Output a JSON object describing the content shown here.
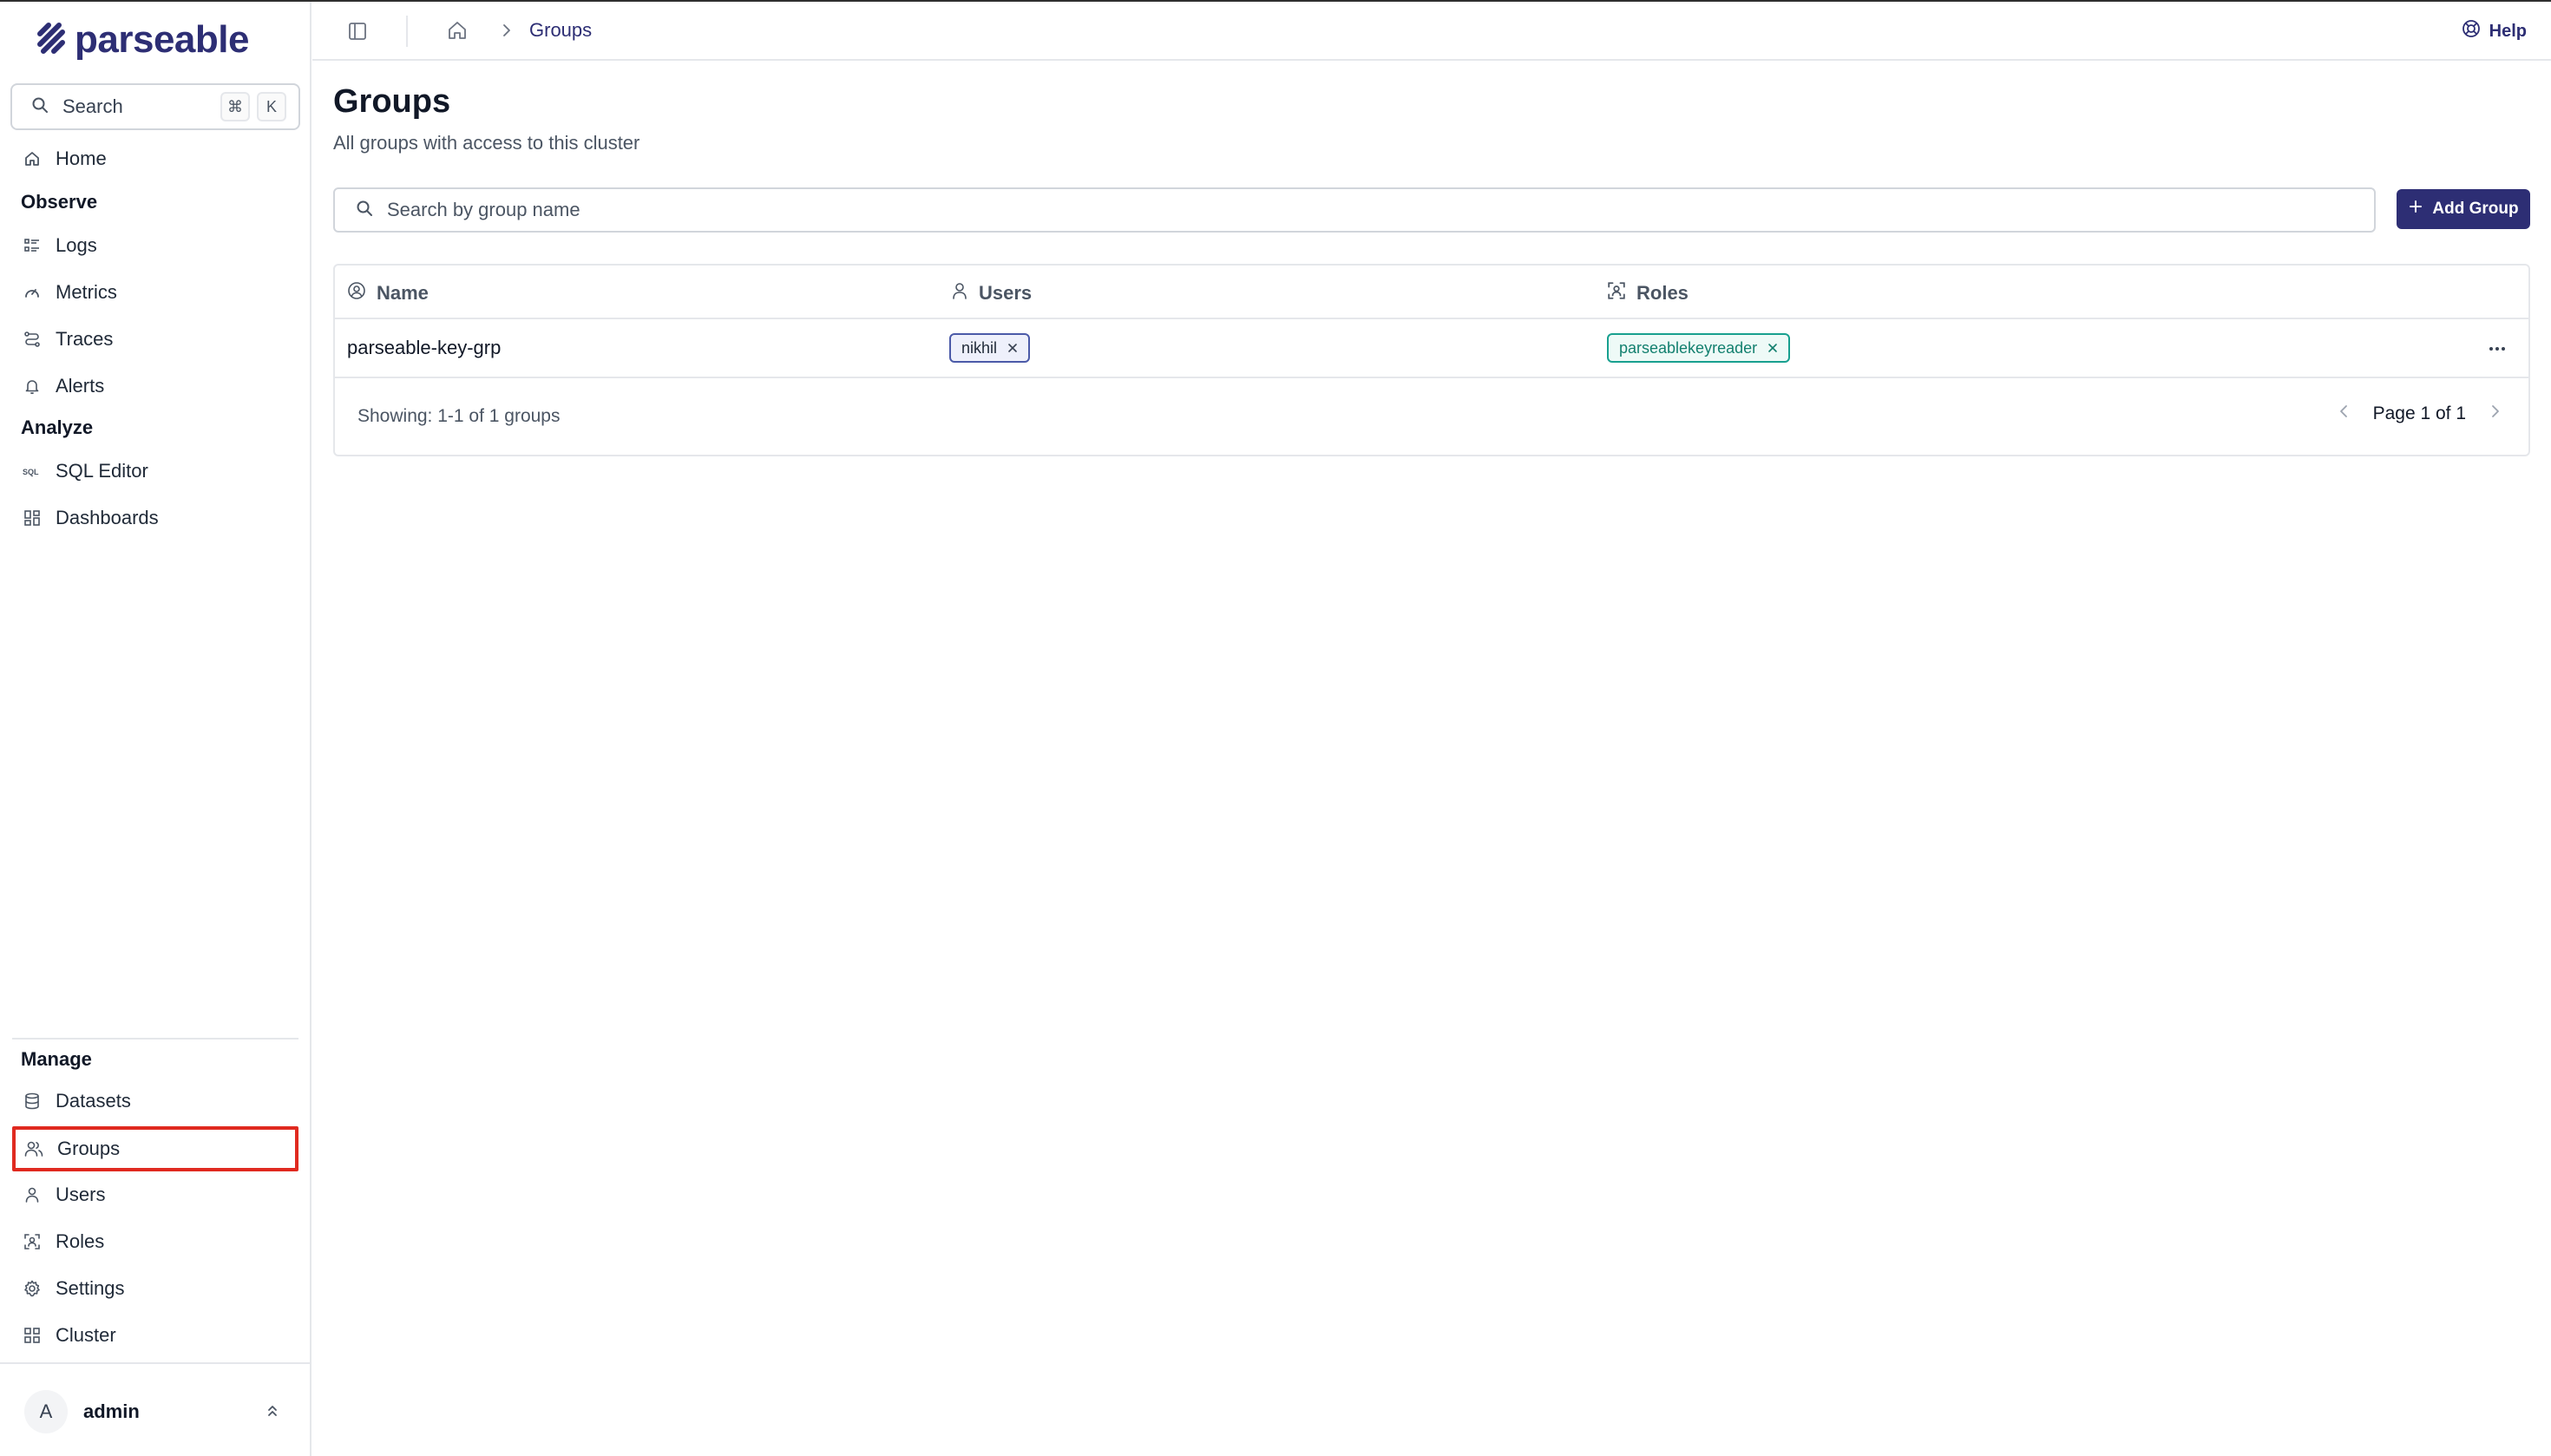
{
  "app": {
    "logo_text": "parseable",
    "colors": {
      "brand": "#2d2e74",
      "active_outline": "#e02a20",
      "role_chip": "#18a08f"
    }
  },
  "sidebar": {
    "search_label": "Search",
    "shortcut_keys": [
      "⌘",
      "K"
    ],
    "home": {
      "label": "Home",
      "icon": "home-icon"
    },
    "sections": {
      "observe": "Observe",
      "analyze": "Analyze",
      "manage": "Manage"
    },
    "observe_items": [
      {
        "label": "Logs",
        "icon": "logs-icon"
      },
      {
        "label": "Metrics",
        "icon": "metrics-icon"
      },
      {
        "label": "Traces",
        "icon": "traces-icon"
      },
      {
        "label": "Alerts",
        "icon": "bell-icon"
      }
    ],
    "analyze_items": [
      {
        "label": "SQL Editor",
        "icon": "sql-icon"
      },
      {
        "label": "Dashboards",
        "icon": "dashboards-icon"
      }
    ],
    "manage_items": [
      {
        "label": "Datasets",
        "icon": "database-icon"
      },
      {
        "label": "Groups",
        "icon": "groups-icon",
        "active": true
      },
      {
        "label": "Users",
        "icon": "user-icon"
      },
      {
        "label": "Roles",
        "icon": "roles-icon"
      },
      {
        "label": "Settings",
        "icon": "gear-icon"
      },
      {
        "label": "Cluster",
        "icon": "cluster-icon"
      }
    ],
    "user": {
      "initial": "A",
      "name": "admin"
    }
  },
  "topbar": {
    "breadcrumb": "Groups",
    "help": "Help"
  },
  "main": {
    "title": "Groups",
    "subtitle": "All groups with access to this cluster",
    "search_placeholder": "Search by group name",
    "add_button": "Add Group",
    "table": {
      "columns": [
        "Name",
        "Users",
        "Roles"
      ],
      "rows": [
        {
          "name": "parseable-key-grp",
          "users": [
            "nikhil"
          ],
          "roles": [
            "parseablekeyreader"
          ]
        }
      ],
      "footer": "Showing: 1-1 of 1 groups",
      "pagination": "Page 1 of 1"
    }
  }
}
